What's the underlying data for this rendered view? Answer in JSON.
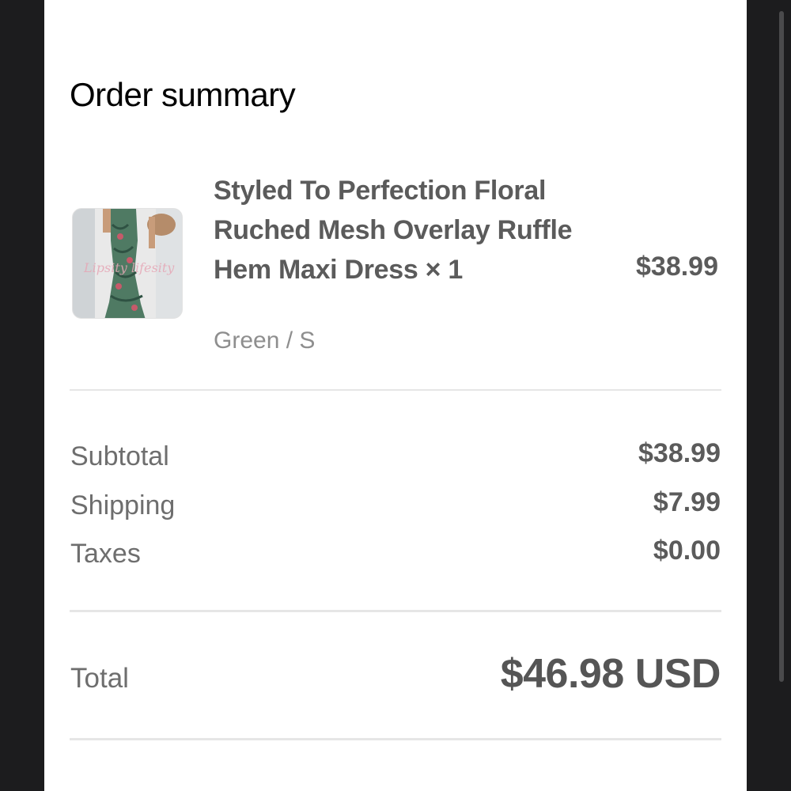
{
  "order_summary": {
    "title": "Order summary",
    "item": {
      "name": "Styled To Perfection Floral Ruched Mesh Overlay Ruffle Hem Maxi Dress × 1",
      "variant": "Green / S",
      "price": "$38.99",
      "image": "floral-maxi-dress-photo",
      "watermark_text": "Lipsity lifesity"
    },
    "subtotal": {
      "label": "Subtotal",
      "value": "$38.99"
    },
    "shipping": {
      "label": "Shipping",
      "value": "$7.99"
    },
    "taxes": {
      "label": "Taxes",
      "value": "$0.00"
    },
    "total": {
      "label": "Total",
      "value": "$46.98 USD"
    }
  },
  "colors": {
    "panel_background": "#ffffff",
    "outer_background": "#1c1c1e",
    "primary_text": "#000000",
    "secondary_text": "#5b5b5b",
    "muted_text": "#8e8e8e"
  }
}
